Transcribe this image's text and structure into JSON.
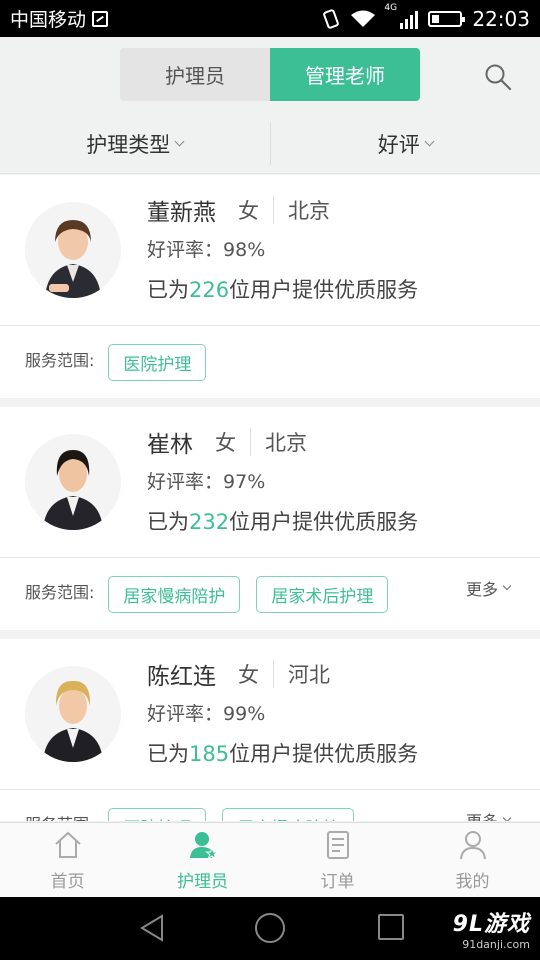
{
  "status_bar": {
    "carrier": "中国移动",
    "network": "4G",
    "time": "22:03"
  },
  "header": {
    "tabs": [
      {
        "label": "护理员",
        "active": false
      },
      {
        "label": "管理老师",
        "active": true
      }
    ],
    "search_icon": "search-icon"
  },
  "filter": {
    "type_label": "护理类型",
    "sort_label": "好评"
  },
  "caregivers": [
    {
      "name": "董新燕",
      "gender": "女",
      "city": "北京",
      "rate_label": "好评率：",
      "rate": "98%",
      "served_prefix": "已为",
      "served_count": "226",
      "served_suffix": "位用户提供优质服务",
      "scope_label": "服务范围:",
      "tags": [
        "医院护理"
      ],
      "more": ""
    },
    {
      "name": "崔林",
      "gender": "女",
      "city": "北京",
      "rate_label": "好评率：",
      "rate": "97%",
      "served_prefix": "已为",
      "served_count": "232",
      "served_suffix": "位用户提供优质服务",
      "scope_label": "服务范围:",
      "tags": [
        "居家慢病陪护",
        "居家术后护理"
      ],
      "more": "更多"
    },
    {
      "name": "陈红连",
      "gender": "女",
      "city": "河北",
      "rate_label": "好评率：",
      "rate": "99%",
      "served_prefix": "已为",
      "served_count": "185",
      "served_suffix": "位用户提供优质服务",
      "scope_label": "服务范围:",
      "tags": [
        "医院护理",
        "居家慢病陪护"
      ],
      "more": "更多"
    }
  ],
  "bottom_nav": [
    {
      "label": "首页",
      "icon": "home-icon",
      "active": false
    },
    {
      "label": "护理员",
      "icon": "caregiver-icon",
      "active": true
    },
    {
      "label": "订单",
      "icon": "order-icon",
      "active": false
    },
    {
      "label": "我的",
      "icon": "profile-icon",
      "active": false
    }
  ],
  "watermark": {
    "brand": "9L游戏",
    "site": "91danji.com"
  },
  "colors": {
    "accent": "#3cbf94",
    "tag_border": "#7dd3b3"
  }
}
